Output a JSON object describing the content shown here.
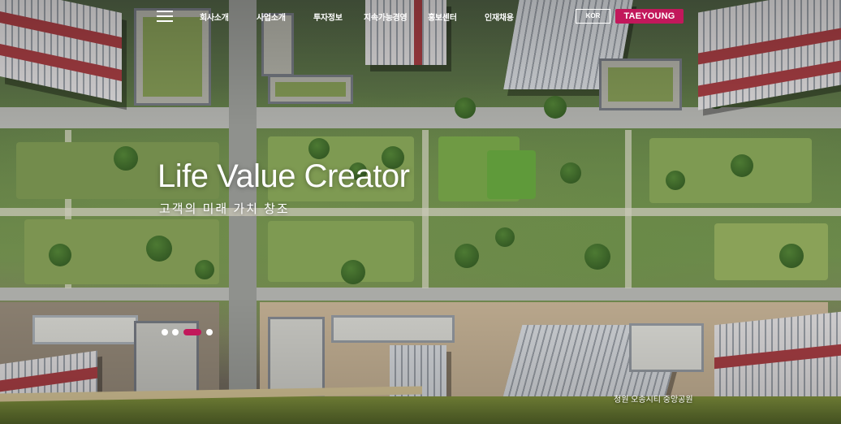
{
  "header": {
    "menu_icon": "hamburger-menu-icon",
    "nav": [
      "회사소개",
      "사업소개",
      "투자정보",
      "지속가능경영",
      "홍보센터",
      "인재채용"
    ],
    "lang": "KOR",
    "brand": "TAEYOUNG",
    "brand_color": "#c2185b"
  },
  "hero": {
    "title": "Life Value Creator",
    "subtitle": "고객의 미래 가치 창조",
    "slide_count": 4,
    "active_slide": 3,
    "caption": "청원 오송시티 중앙공원"
  }
}
